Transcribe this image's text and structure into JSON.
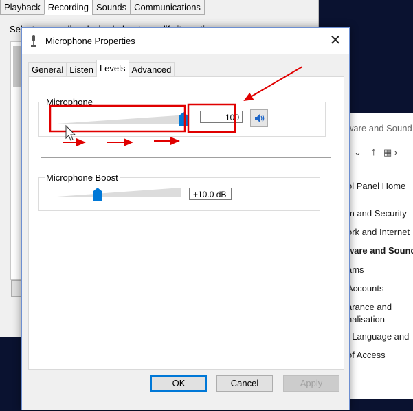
{
  "background_dialog": {
    "tabs": [
      "Playback",
      "Recording",
      "Sounds",
      "Communications"
    ],
    "active_tab": 1,
    "description": "Select a recording device below to modify its settings:"
  },
  "control_panel": {
    "title": "ware and Sound",
    "items": [
      {
        "label": "ol Panel Home",
        "bold": false
      },
      {
        "label": "m and Security",
        "bold": false
      },
      {
        "label": "ork and Internet",
        "bold": false
      },
      {
        "label": "ware and Sound",
        "bold": true
      },
      {
        "label": "ams",
        "bold": false
      },
      {
        "label": "Accounts",
        "bold": false
      },
      {
        "label": "arance and",
        "bold": false
      },
      {
        "label": "nalisation",
        "bold": false
      },
      {
        "label": ", Language and",
        "bold": false
      },
      {
        "label": "of Access",
        "bold": false
      }
    ]
  },
  "dialog": {
    "title": "Microphone Properties",
    "close_glyph": "✕",
    "tabs": [
      "General",
      "Listen",
      "Levels",
      "Advanced"
    ],
    "active_tab": 2,
    "microphone": {
      "label": "Microphone",
      "value": "100",
      "level_fraction": 1.0
    },
    "boost": {
      "label": "Microphone Boost",
      "value": "+10.0 dB",
      "level_fraction": 0.33
    },
    "buttons": {
      "ok": "OK",
      "cancel": "Cancel",
      "apply": "Apply"
    }
  },
  "icons": {
    "dialog_icon": "microphone-icon",
    "speaker": "speaker-icon",
    "cursor": "mouse-pointer-icon"
  },
  "colors": {
    "thumb": "#0078d7",
    "annotation": "#e00000",
    "dialog_border": "#6d8fd1"
  }
}
